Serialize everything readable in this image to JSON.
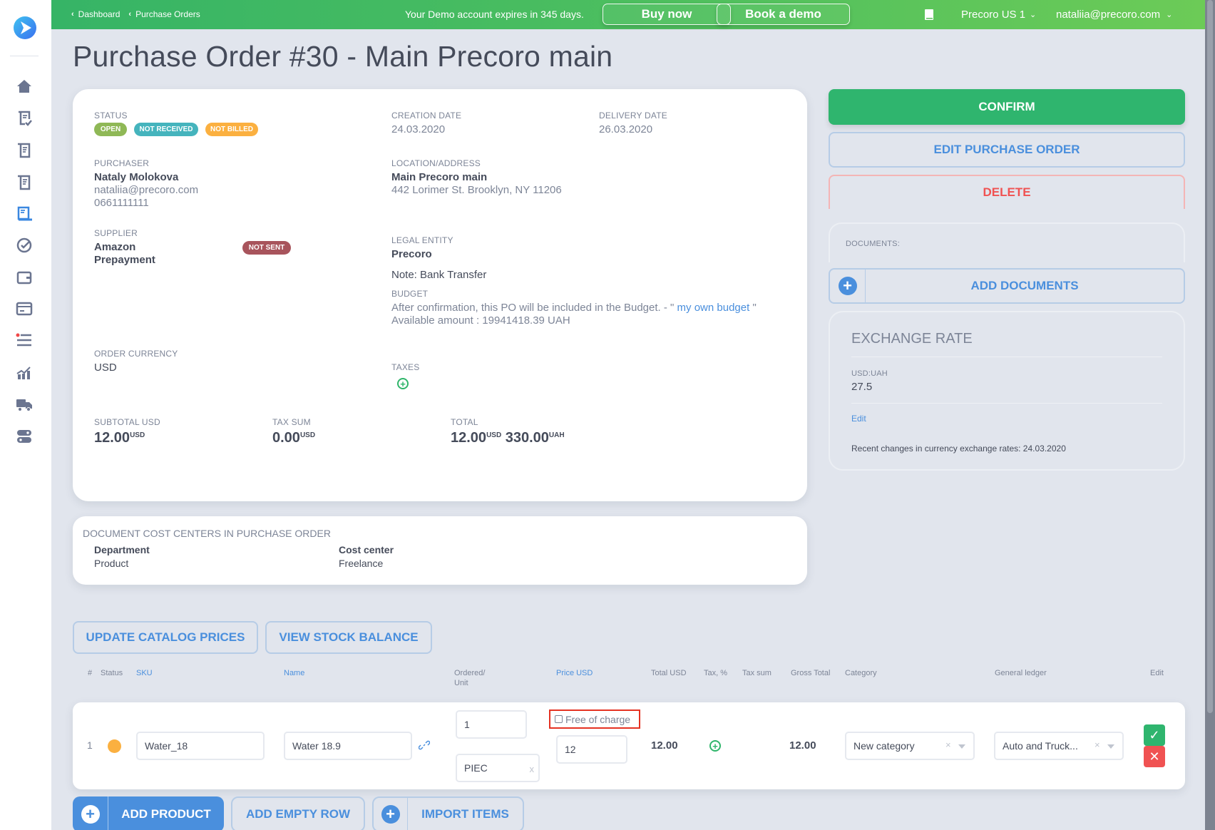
{
  "topbar": {
    "breadcrumbs": [
      "Dashboard",
      "Purchase Orders"
    ],
    "demo_text": "Your Demo account expires in 345 days.",
    "buy_now": "Buy now",
    "book_demo": "Book a demo",
    "company": "Precoro US 1",
    "user_email": "nataliia@precoro.com"
  },
  "sidebar": {
    "items": [
      {
        "icon": "home-icon"
      },
      {
        "icon": "approval-icon"
      },
      {
        "icon": "request-icon"
      },
      {
        "icon": "document-icon"
      },
      {
        "icon": "purchase-order-icon",
        "active": true
      },
      {
        "icon": "check-circle-icon"
      },
      {
        "icon": "wallet-icon"
      },
      {
        "icon": "card-icon"
      },
      {
        "icon": "list-icon",
        "notification": true
      },
      {
        "icon": "analytics-icon"
      },
      {
        "icon": "truck-icon"
      },
      {
        "icon": "settings-toggle-icon"
      }
    ]
  },
  "page_title": "Purchase Order #30 - Main Precoro main",
  "details": {
    "status_label": "STATUS",
    "statuses": [
      {
        "text": "OPEN",
        "color": "#8fb856"
      },
      {
        "text": "NOT RECEIVED",
        "color": "#45b4bd"
      },
      {
        "text": "NOT BILLED",
        "color": "#fbb040"
      }
    ],
    "creation_date_label": "CREATION DATE",
    "creation_date": "24.03.2020",
    "delivery_date_label": "DELIVERY DATE",
    "delivery_date": "26.03.2020",
    "purchaser_label": "PURCHASER",
    "purchaser_name": "Nataly Molokova",
    "purchaser_email": "nataliia@precoro.com",
    "purchaser_phone": "0661111111",
    "location_label": "LOCATION/ADDRESS",
    "location_name": "Main Precoro main",
    "location_address": "442 Lorimer St. Brooklyn, NY 11206",
    "supplier_label": "SUPPLIER",
    "supplier_name": "Amazon",
    "supplier_payment": "Prepayment",
    "supplier_badge": "NOT SENT",
    "legal_entity_label": "LEGAL ENTITY",
    "legal_entity": "Precoro",
    "note": "Note: Bank Transfer",
    "budget_label": "BUDGET",
    "budget_text": "After confirmation, this PO will be included in the Budget. - \"",
    "budget_link": "my own budget",
    "budget_close": "\"",
    "budget_available": "Available amount : 19941418.39 UAH",
    "order_currency_label": "ORDER CURRENCY",
    "order_currency": "USD",
    "taxes_label": "TAXES",
    "subtotal_label": "SUBTOTAL USD",
    "subtotal": "12.00",
    "subtotal_cur": "USD",
    "tax_sum_label": "TAX SUM",
    "tax_sum": "0.00",
    "tax_sum_cur": "USD",
    "total_label": "TOTAL",
    "total_usd": "12.00",
    "total_usd_cur": "USD",
    "total_uah": "330.00",
    "total_uah_cur": "UAH"
  },
  "cost_centers": {
    "title": "DOCUMENT COST CENTERS IN PURCHASE ORDER",
    "columns": [
      {
        "header": "Department",
        "value": "Product"
      },
      {
        "header": "Cost center",
        "value": "Freelance"
      }
    ]
  },
  "actions": {
    "confirm": "CONFIRM",
    "edit": "EDIT PURCHASE ORDER",
    "delete": "DELETE",
    "documents_label": "DOCUMENTS:",
    "add_documents": "ADD DOCUMENTS"
  },
  "exchange": {
    "title": "EXCHANGE RATE",
    "pair": "USD:UAH",
    "rate": "27.5",
    "edit": "Edit",
    "recent": "Recent changes in currency exchange rates: 24.03.2020"
  },
  "items": {
    "update_catalog": "UPDATE CATALOG PRICES",
    "view_stock": "VIEW STOCK BALANCE",
    "headers": {
      "num": "#",
      "status": "Status",
      "sku": "SKU",
      "name": "Name",
      "ordered": "Ordered/",
      "unit": "Unit",
      "price": "Price USD",
      "total": "Total USD",
      "tax": "Tax, %",
      "tax_sum": "Tax sum",
      "gross": "Gross Total",
      "category": "Category",
      "ledger": "General ledger",
      "edit": "Edit"
    },
    "rows": [
      {
        "num": "1",
        "status_color": "#fbb040",
        "sku": "Water_18",
        "name": "Water 18.9",
        "qty": "1",
        "unit": "PIEC",
        "free_of_charge": "Free of charge",
        "price": "12",
        "total": "12.00",
        "gross": "12.00",
        "category": "New category",
        "ledger": "Auto and Truck..."
      }
    ],
    "add_product": "ADD PRODUCT",
    "add_empty_row": "ADD EMPTY ROW",
    "import_items": "IMPORT ITEMS"
  }
}
